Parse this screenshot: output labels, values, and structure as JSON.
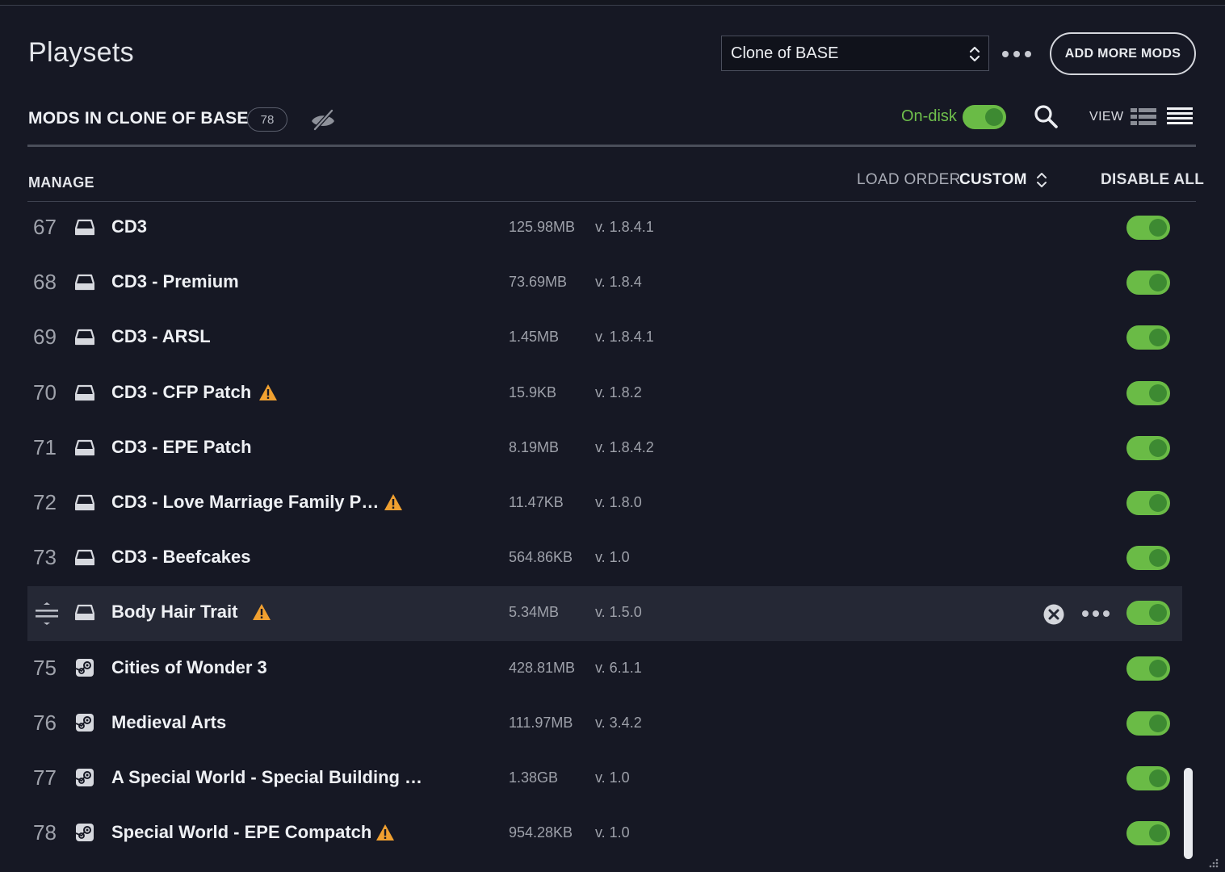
{
  "header": {
    "title": "Playsets",
    "playset_selected": "Clone of BASE",
    "add_button": "ADD MORE MODS"
  },
  "toolbar": {
    "mods_title": "MODS IN CLONE OF BASE",
    "mod_count": "78",
    "ondisk_label": "On-disk",
    "ondisk_enabled": true,
    "view_label": "VIEW"
  },
  "manage": {
    "label": "MANAGE",
    "load_order_label": "LOAD ORDER",
    "load_order_value": "CUSTOM",
    "disable_all": "DISABLE ALL"
  },
  "colors": {
    "accent_green": "#6abb46",
    "warning": "#f0a030",
    "background": "#161824"
  },
  "mods": [
    {
      "num": "67",
      "source": "disk-icon",
      "name": "CD3",
      "warn": false,
      "size": "125.98MB",
      "version": "v. 1.8.4.1",
      "enabled": true
    },
    {
      "num": "68",
      "source": "disk-icon",
      "name": "CD3 - Premium",
      "warn": false,
      "size": "73.69MB",
      "version": "v. 1.8.4",
      "enabled": true
    },
    {
      "num": "69",
      "source": "disk-icon",
      "name": "CD3 - ARSL",
      "warn": false,
      "size": "1.45MB",
      "version": "v. 1.8.4.1",
      "enabled": true
    },
    {
      "num": "70",
      "source": "disk-icon",
      "name": "CD3 - CFP Patch",
      "warn": true,
      "size": "15.9KB",
      "version": "v. 1.8.2",
      "enabled": true
    },
    {
      "num": "71",
      "source": "disk-icon",
      "name": "CD3 - EPE Patch",
      "warn": false,
      "size": "8.19MB",
      "version": "v. 1.8.4.2",
      "enabled": true
    },
    {
      "num": "72",
      "source": "disk-icon",
      "name": "CD3 - Love Marriage Family P…",
      "warn": true,
      "size": "11.47KB",
      "version": "v. 1.8.0",
      "enabled": true
    },
    {
      "num": "73",
      "source": "disk-icon",
      "name": "CD3 - Beefcakes",
      "warn": false,
      "size": "564.86KB",
      "version": "v. 1.0",
      "enabled": true
    },
    {
      "num": "",
      "source": "disk-icon",
      "name": "Body Hair Trait",
      "warn": true,
      "size": "5.34MB",
      "version": "v. 1.5.0",
      "enabled": true,
      "hovered": true
    },
    {
      "num": "75",
      "source": "steam-icon",
      "name": "Cities of Wonder 3",
      "warn": false,
      "size": "428.81MB",
      "version": "v. 6.1.1",
      "enabled": true
    },
    {
      "num": "76",
      "source": "steam-icon",
      "name": "Medieval Arts",
      "warn": false,
      "size": "111.97MB",
      "version": "v. 3.4.2",
      "enabled": true
    },
    {
      "num": "77",
      "source": "steam-icon",
      "name": "A Special World - Special Building …",
      "warn": false,
      "size": "1.38GB",
      "version": "v. 1.0",
      "enabled": true
    },
    {
      "num": "78",
      "source": "steam-icon",
      "name": "Special World - EPE Compatch",
      "warn": true,
      "size": "954.28KB",
      "version": "v. 1.0",
      "enabled": true
    }
  ]
}
